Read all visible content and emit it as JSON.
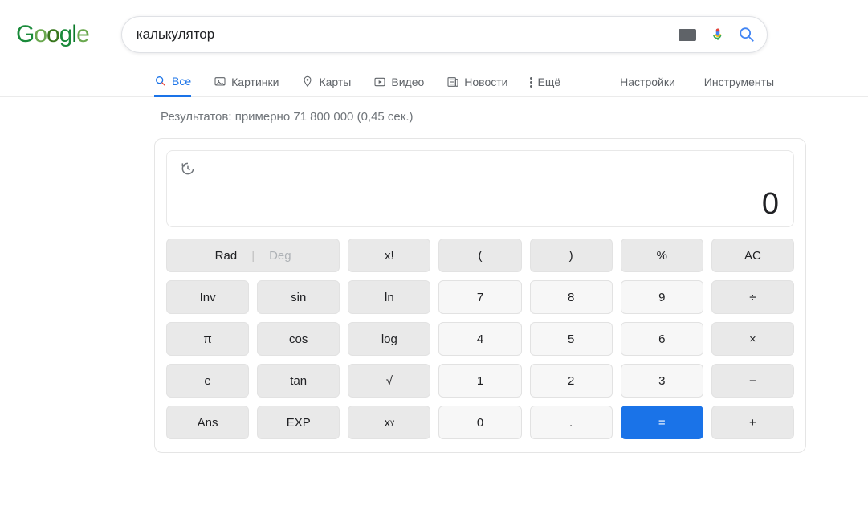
{
  "search": {
    "query": "калькулятор"
  },
  "nav": {
    "all": "Все",
    "images": "Картинки",
    "maps": "Карты",
    "videos": "Видео",
    "news": "Новости",
    "more": "Ещё",
    "settings": "Настройки",
    "tools": "Инструменты"
  },
  "results": {
    "stats": "Результатов: примерно 71 800 000 (0,45 сек.)"
  },
  "calc": {
    "display": "0",
    "keys": {
      "rad": "Rad",
      "deg": "Deg",
      "fact": "x!",
      "lparen": "(",
      "rparen": ")",
      "percent": "%",
      "ac": "AC",
      "inv": "Inv",
      "sin": "sin",
      "ln": "ln",
      "n7": "7",
      "n8": "8",
      "n9": "9",
      "div": "÷",
      "pi": "π",
      "cos": "cos",
      "log": "log",
      "n4": "4",
      "n5": "5",
      "n6": "6",
      "mul": "×",
      "e": "e",
      "tan": "tan",
      "sqrt": "√",
      "n1": "1",
      "n2": "2",
      "n3": "3",
      "sub": "−",
      "ans": "Ans",
      "exp": "EXP",
      "pow_prefix": "x",
      "pow_super": "y",
      "n0": "0",
      "dot": ".",
      "eq": "=",
      "add": "+"
    }
  }
}
